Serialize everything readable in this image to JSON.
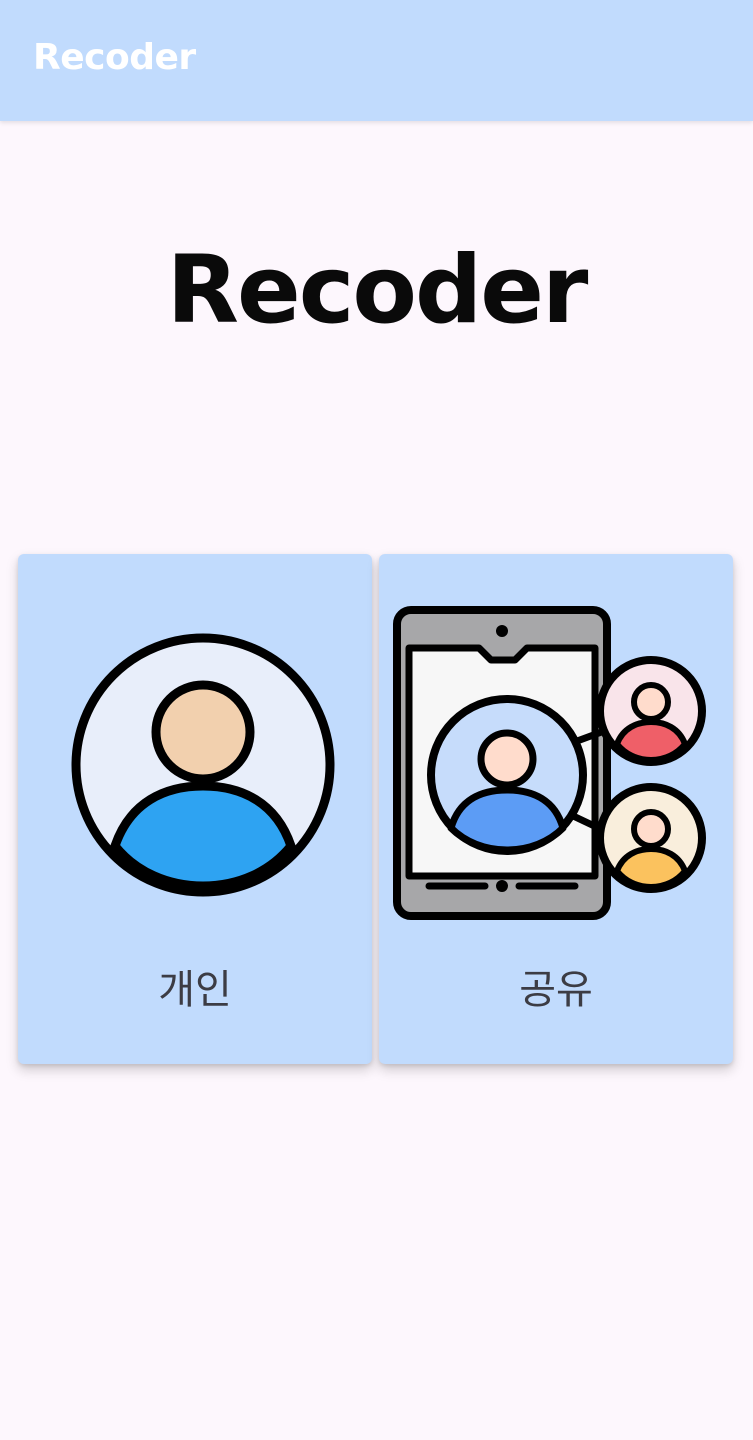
{
  "app_bar": {
    "title": "Recoder"
  },
  "hero": {
    "title": "Recoder"
  },
  "cards": [
    {
      "label": "개인",
      "icon": "user-profile-icon"
    },
    {
      "label": "공유",
      "icon": "shared-users-tablet-icon"
    }
  ],
  "colors": {
    "app_bar_background": "#c1dbfd",
    "page_background": "#fdf7fd",
    "card_background": "#c1dbfd",
    "label_text": "#3c3c44"
  }
}
